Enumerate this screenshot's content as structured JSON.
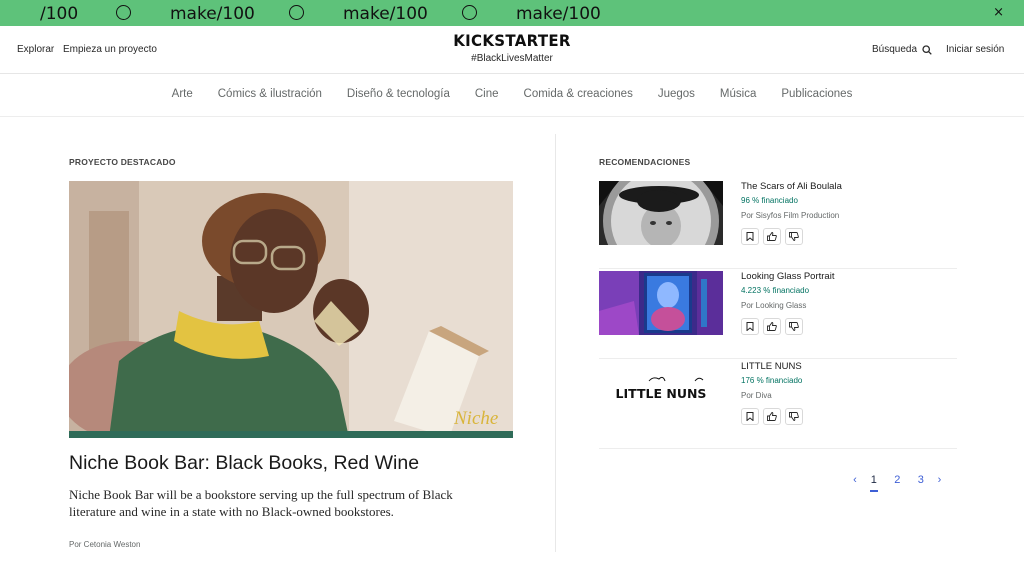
{
  "banner": {
    "items": [
      "/100",
      "make/100",
      "make/100",
      "make/100"
    ],
    "close": "×"
  },
  "header": {
    "explore": "Explorar",
    "start_project": "Empieza un proyecto",
    "logo": "KICKSTARTER",
    "tagline": "#BlackLivesMatter",
    "search": "Búsqueda",
    "login": "Iniciar sesión"
  },
  "categories": [
    "Arte",
    "Cómics & ilustración",
    "Diseño & tecnología",
    "Cine",
    "Comida & creaciones",
    "Juegos",
    "Música",
    "Publicaciones"
  ],
  "featured": {
    "label": "PROYECTO DESTACADO",
    "image_watermark": "Niche",
    "title": "Niche Book Bar: Black Books, Red Wine",
    "description": "Niche Book Bar will be a bookstore serving up the full spectrum of Black literature and wine in a state with no Black-owned bookstores.",
    "by": "Por Cetonia Weston"
  },
  "recommendations": {
    "label": "RECOMENDACIONES",
    "items": [
      {
        "title": "The Scars of Ali Boulala",
        "funded": "96 % financiado",
        "by": "Por Sisyfos Film Production"
      },
      {
        "title": "Looking Glass Portrait",
        "funded": "4.223 % financiado",
        "by": "Por Looking Glass"
      },
      {
        "title": "LITTLE NUNS",
        "funded": "176 % financiado",
        "by": "Por Diva",
        "thumb_text": "LITTLE NUNS"
      }
    ]
  },
  "pagination": {
    "prev": "‹",
    "pages": [
      "1",
      "2",
      "3"
    ],
    "next": "›"
  },
  "colors": {
    "banner": "#5ec27a",
    "funded": "#037362",
    "pager": "#3e5fd5"
  }
}
